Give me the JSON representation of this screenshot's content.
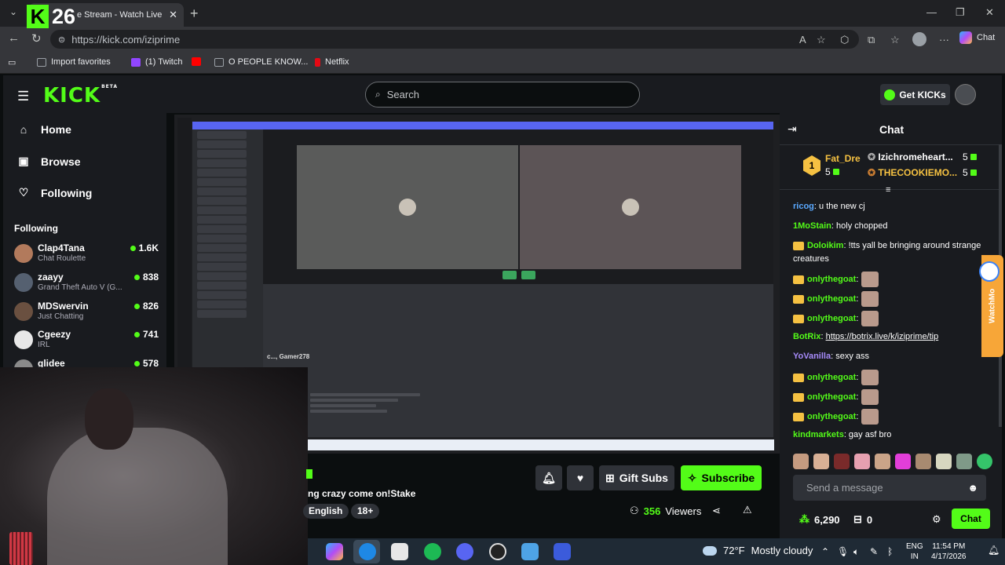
{
  "browser": {
    "tab_title": "e Stream - Watch Live",
    "overlay_badge": "26",
    "url": "https://kick.com/iziprime",
    "chat_label": "Chat",
    "bookmarks": [
      {
        "label": "Import favorites",
        "color": "#9aa0a6"
      },
      {
        "label": "(1) Twitch",
        "color": "#9146ff"
      },
      {
        "label": "",
        "color": "#ff0000"
      },
      {
        "label": "O PEOPLE KNOW...",
        "color": "#9aa0a6"
      },
      {
        "label": "Netflix",
        "color": "#e50914"
      }
    ]
  },
  "header": {
    "logo": "KICK",
    "logo_sup": "BETA",
    "search_placeholder": "Search",
    "get_kicks": "Get KICKs"
  },
  "sidebar": {
    "nav": [
      {
        "label": "Home",
        "icon": "home-icon"
      },
      {
        "label": "Browse",
        "icon": "browse-icon"
      },
      {
        "label": "Following",
        "icon": "heart-icon"
      }
    ],
    "following_heading": "Following",
    "following": [
      {
        "name": "Clap4Tana",
        "category": "Chat Roulette",
        "viewers": "1.6K",
        "color": "#b27a5c"
      },
      {
        "name": "zaayy",
        "category": "Grand Theft Auto V (G...",
        "viewers": "838",
        "color": "#556070"
      },
      {
        "name": "MDSwervin",
        "category": "Just Chatting",
        "viewers": "826",
        "color": "#6a5040"
      },
      {
        "name": "Cgeezy",
        "category": "IRL",
        "viewers": "741",
        "color": "#e8e8e8"
      },
      {
        "name": "glidee",
        "category": "",
        "viewers": "578",
        "color": "#8a8a8a"
      }
    ]
  },
  "stream": {
    "video_group_name": "c..., Gamer278",
    "title": "ng crazy come on!Stake",
    "tags": [
      "English",
      "18+"
    ],
    "gift_subs": "Gift Subs",
    "subscribe": "Subscribe",
    "viewers": "356",
    "viewers_label": "Viewers"
  },
  "chat": {
    "title": "Chat",
    "top_gifters": [
      {
        "name": "Fat_Dre",
        "count": "5",
        "color": "#f5c142"
      },
      {
        "name": "Izichromeheart...",
        "count": "5",
        "color": "#ffffff"
      },
      {
        "name": "THECOOKIEMO...",
        "count": "5",
        "color": "#f5c142"
      }
    ],
    "gifter_rank": "1",
    "messages": [
      {
        "user": "ricog",
        "text": ": u the new cj",
        "color": "#5aa9ff",
        "crown": false,
        "emote": false,
        "link": ""
      },
      {
        "user": "1MoStain",
        "text": ": holy chopped",
        "color": "#53fc18",
        "crown": false,
        "emote": false,
        "link": ""
      },
      {
        "user": "Doloikim",
        "text": ": !tts yall be bringing around strange creatures",
        "color": "#53fc18",
        "crown": true,
        "emote": false,
        "link": ""
      },
      {
        "user": "onlythegoat",
        "text": ":",
        "color": "#53fc18",
        "crown": true,
        "emote": true,
        "link": ""
      },
      {
        "user": "onlythegoat",
        "text": ":",
        "color": "#53fc18",
        "crown": true,
        "emote": true,
        "link": ""
      },
      {
        "user": "onlythegoat",
        "text": ":",
        "color": "#53fc18",
        "crown": true,
        "emote": true,
        "link": ""
      },
      {
        "user": "BotRix",
        "text": ": ",
        "color": "#53fc18",
        "crown": false,
        "emote": false,
        "link": "https://botrix.live/k/iziprime/tip"
      },
      {
        "user": "YoVanilla",
        "text": ": sexy ass",
        "color": "#a78bfa",
        "crown": false,
        "emote": false,
        "link": ""
      },
      {
        "user": "onlythegoat",
        "text": ":",
        "color": "#53fc18",
        "crown": true,
        "emote": true,
        "link": ""
      },
      {
        "user": "onlythegoat",
        "text": ":",
        "color": "#53fc18",
        "crown": true,
        "emote": true,
        "link": ""
      },
      {
        "user": "onlythegoat",
        "text": ":",
        "color": "#53fc18",
        "crown": true,
        "emote": true,
        "link": ""
      },
      {
        "user": "kindmarkets",
        "text": ": gay asf bro",
        "color": "#53fc18",
        "crown": false,
        "emote": false,
        "link": ""
      }
    ],
    "send_placeholder": "Send a message",
    "points": "6,290",
    "channel_points": "0",
    "send_button": "Chat",
    "watchmo": "WatchMo"
  },
  "taskbar": {
    "weather_temp": "72°F",
    "weather_text": "Mostly cloudy",
    "lang_line1": "ENG",
    "lang_line2": "IN",
    "time": "11:54 PM",
    "date": "4/17/2026"
  }
}
